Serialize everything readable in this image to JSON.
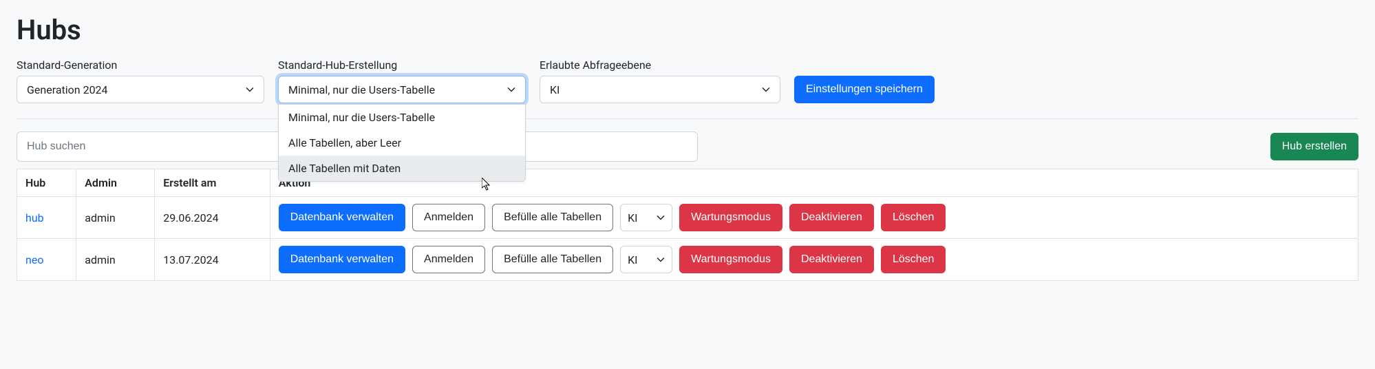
{
  "page_title": "Hubs",
  "settings": {
    "generation": {
      "label": "Standard-Generation",
      "value": "Generation 2024"
    },
    "hub_creation": {
      "label": "Standard-Hub-Erstellung",
      "value": "Minimal, nur die Users-Tabelle",
      "options": [
        "Minimal, nur die Users-Tabelle",
        "Alle Tabellen, aber Leer",
        "Alle Tabellen mit Daten"
      ]
    },
    "query_level": {
      "label": "Erlaubte Abfrageebene",
      "value": "KI"
    },
    "save_button": "Einstellungen speichern"
  },
  "search": {
    "placeholder": "Hub suchen"
  },
  "create_button": "Hub erstellen",
  "table": {
    "headers": {
      "hub": "Hub",
      "admin": "Admin",
      "created": "Erstellt am",
      "action": "Aktion"
    },
    "action_labels": {
      "manage_db": "Datenbank verwalten",
      "login": "Anmelden",
      "fill_tables": "Befülle alle Tabellen",
      "level": "KI",
      "maintenance": "Wartungsmodus",
      "deactivate": "Deaktivieren",
      "delete": "Löschen"
    },
    "rows": [
      {
        "hub": "hub",
        "admin": "admin",
        "created": "29.06.2024"
      },
      {
        "hub": "neo",
        "admin": "admin",
        "created": "13.07.2024"
      }
    ]
  }
}
